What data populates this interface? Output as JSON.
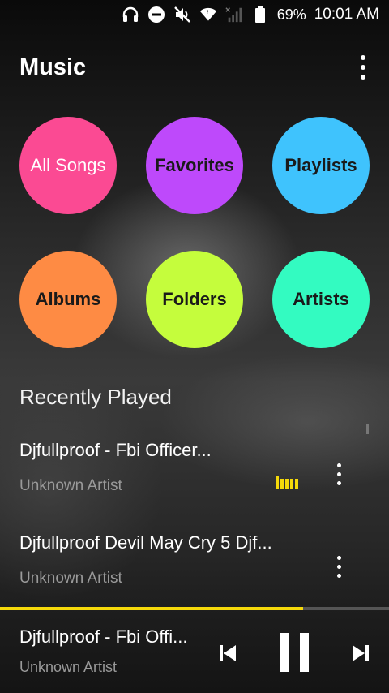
{
  "status": {
    "battery": "69%",
    "time": "10:01 AM",
    "icons": [
      "headphones-icon",
      "dnd-icon",
      "muted-icon",
      "wifi-icon",
      "no-signal-icon",
      "battery-icon"
    ]
  },
  "header": {
    "title": "Music",
    "menu_icon": "more-vert-icon"
  },
  "categories": [
    {
      "label": "All Songs",
      "color": "#FB4A93",
      "text_color": "#ffffff"
    },
    {
      "label": "Favorites",
      "color": "#BE49FB",
      "text_color": "#1a1a1a"
    },
    {
      "label": "Playlists",
      "color": "#3FC3FD",
      "text_color": "#1a1a1a"
    },
    {
      "label": "Albums",
      "color": "#FE8B44",
      "text_color": "#1a1a1a"
    },
    {
      "label": "Folders",
      "color": "#C5FD3C",
      "text_color": "#1a1a1a"
    },
    {
      "label": "Artists",
      "color": "#33FBC1",
      "text_color": "#1a1a1a"
    }
  ],
  "recent": {
    "title": "Recently Played",
    "tracks": [
      {
        "title": "Djfullproof - Fbi Officer...",
        "artist": "Unknown Artist",
        "playing": true
      },
      {
        "title": "Djfullproof Devil May Cry 5 Djf...",
        "artist": "Unknown Artist",
        "playing": false
      }
    ]
  },
  "player": {
    "title": "Djfullproof - Fbi Offi...",
    "artist": "Unknown Artist",
    "progress": 0.78,
    "accent": "#F5D90A"
  }
}
